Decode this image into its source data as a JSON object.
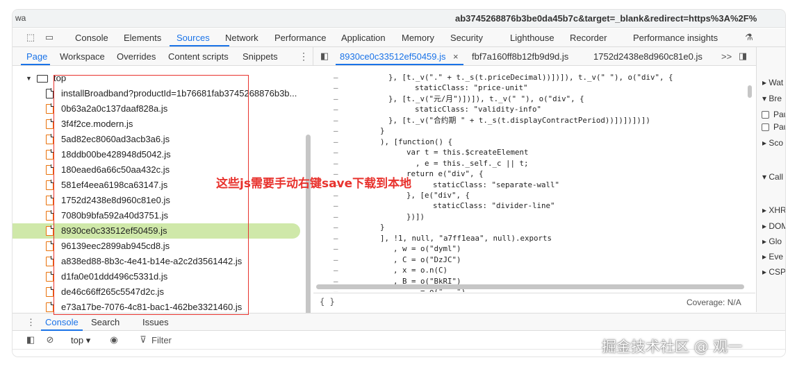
{
  "window": {
    "url_prefix": "wa",
    "url_visible": "ab3745268876b3be0da45b7c&target=_blank&redirect=https%3A%2F%"
  },
  "devtools": {
    "main_tabs": [
      "Console",
      "Elements",
      "Sources",
      "Network",
      "Performance",
      "Application",
      "Memory",
      "Security",
      "Lighthouse",
      "Recorder",
      "Performance insights"
    ],
    "active_main_tab": "Sources"
  },
  "navigator": {
    "tabs": [
      "Page",
      "Workspace",
      "Overrides",
      "Content scripts",
      "Snippets"
    ],
    "active_tab": "Page",
    "root": "top",
    "files": [
      "installBroadband?productId=1b76681fab3745268876b3b...",
      "0b63a2a0c137daaf828a.js",
      "3f4f2ce.modern.js",
      "5ad82ec8060ad3acb3a6.js",
      "18ddb00be428948d5042.js",
      "180eaed6a66c50aa432c.js",
      "581ef4eea6198ca63147.js",
      "1752d2438e8d960c81e0.js",
      "7080b9bfa592a40d3751.js",
      "8930ce0c33512ef50459.js",
      "96139eec2899ab945cd8.js",
      "a838ed88-8b3c-4e41-b14e-a2c2d3561442.js",
      "d1fa0e01ddd496c5331d.js",
      "de46c66ff265c5547d2c.js",
      "e73a17be-7076-4c81-bac1-462be3321460.js"
    ],
    "selected_file": "8930ce0c33512ef50459.js"
  },
  "editor": {
    "tabs": [
      "8930ce0c33512ef50459.js",
      "fbf7a160ff8b12fb9d9d.js",
      "1752d2438e8d960c81e0.js"
    ],
    "active_tab": "8930ce0c33512ef50459.js",
    "overflow_label": ">>",
    "lines": [
      "}, [t._v(\".\" + t._s(t.priceDecimal))])]), t._v(\" \"), o(\"div\", {",
      "    staticClass: \"price-unit\"",
      "}, [t._v(\"元/月\")])]), t._v(\" \"), o(\"div\", {",
      "    staticClass: \"validity-info\"",
      "}, [t._v(\"合约期 \" + t._s(t.displayContractPeriod))])])])])",
      "}",
      "), [function() {",
      "    var t = this.$createElement",
      "      , e = this._self._c || t;",
      "    return e(\"div\", {",
      "        staticClass: \"separate-wall\"",
      "    }, [e(\"div\", {",
      "        staticClass: \"divider-line\"",
      "    })])",
      "}",
      "], !1, null, \"a7ff1eaa\", null).exports",
      "  , w = o(\"dyml\")",
      "  , C = o(\"DzJC\")",
      "  , x = o.n(C)",
      "  , B = o(\"BkRI\")",
      "  , ... = o(\"...\")"
    ],
    "footer_braces": "{ }",
    "coverage": "Coverage: N/A"
  },
  "right_panel": {
    "items": [
      "Wat",
      "Bre",
      "Pau",
      "Pau",
      "Sco",
      "Call",
      "XHR",
      "DOM",
      "Glo",
      "Eve",
      "CSP"
    ]
  },
  "drawer": {
    "tabs": [
      "Console",
      "Search",
      "Issues"
    ],
    "active_tab": "Console",
    "context": "top",
    "filter_placeholder": "Filter"
  },
  "annotation": "这些js需要手动右键save下载到本地",
  "watermark": "掘金技术社区 @ 观一",
  "colors": {
    "accent": "#1a73e8",
    "selected_row": "#cfe8a9",
    "annotation_red": "#e8322d",
    "file_icon": "#e8710a"
  }
}
